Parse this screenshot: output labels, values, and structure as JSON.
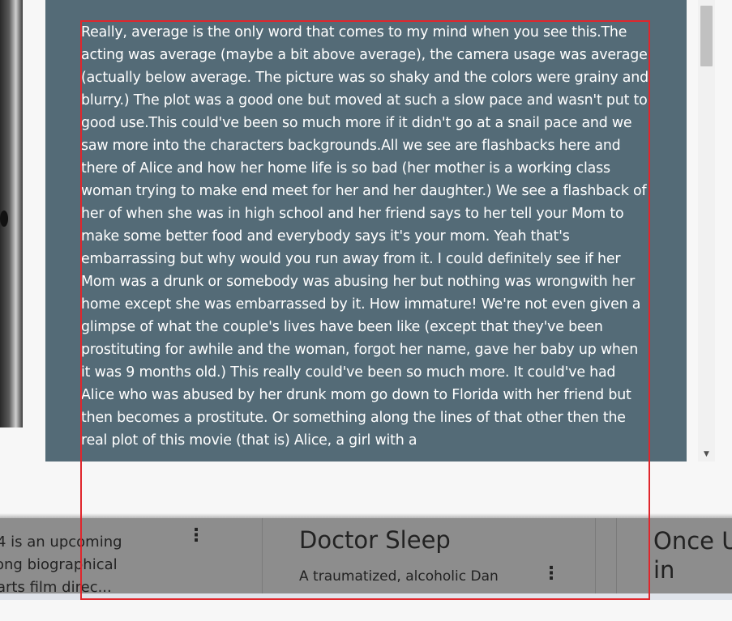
{
  "review": {
    "text": "Really, average is the only word that comes to my mind when you see this.The acting was average (maybe a bit above average), the camera usage was average (actually below average. The picture was so shaky and the colors were grainy and blurry.) The plot was a good one but moved at such a slow pace and wasn't put to good use.This could've been so much more if it didn't go at a snail pace and we saw more into the characters backgrounds.All we see are flashbacks here and there of Alice and how her home life is so bad (her mother is a working class woman trying to make end meet for her and her daughter.) We see a flashback of her of when she was in high school and her friend says to her tell your Mom to make some better food and everybody says it's your mom. Yeah that's embarrassing but why would you run away from it. I could definitely see if her Mom was a drunk or somebody was abusing her but nothing was wrongwith her home except she was embarrassed by it. How immature! We're not even given a glimpse of what the couple's lives have been like (except that they've been prostituting for awhile and the woman, forgot her name, gave her baby up when it was 9 months old.) This really could've been so much more. It could've had Alice who was abused by her drunk mom go down to Florida with her friend but then becomes a prostitute. Or something along the lines of that other then the real plot of this movie (that is) Alice, a girl with a"
  },
  "scrollbar": {
    "down_arrow": "▼"
  },
  "cards": [
    {
      "desc_lines": [
        "4 is an upcoming",
        "ong biographical",
        " arts film direc..."
      ],
      "menu_icon": "⋮"
    },
    {
      "title": "Doctor Sleep",
      "desc": "A traumatized, alcoholic Dan",
      "menu_icon": "⋮"
    },
    {
      "title": "Once U in"
    }
  ],
  "colors": {
    "review_bg": "#546b77",
    "overlay": "#8d8d8d",
    "highlight": "#e0262c"
  }
}
